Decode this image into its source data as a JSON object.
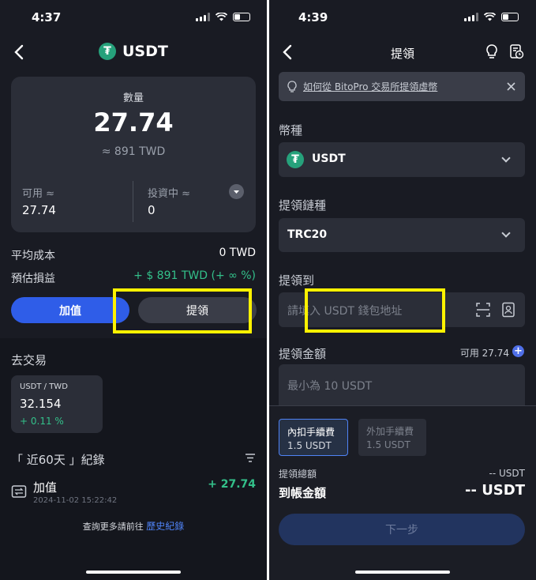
{
  "left": {
    "status_time": "4:37",
    "title": "USDT",
    "qty_label": "數量",
    "qty_value": "27.74",
    "qty_twd": "≈ 891 TWD",
    "available_label": "可用 ≈",
    "available_value": "27.74",
    "investing_label": "投資中 ≈",
    "investing_value": "0",
    "avg_cost_label": "平均成本",
    "avg_cost_value": "0 TWD",
    "pnl_label": "預估損益",
    "pnl_value": "+ $ 891 TWD (+ ∞ %)",
    "deposit_label": "加值",
    "withdraw_label": "提領",
    "trade_heading": "去交易",
    "pair_label": "USDT / TWD",
    "pair_price": "32.154",
    "pair_change": "+ 0.11 %",
    "records_heading": "「 近60天 」紀錄",
    "record_title": "加值",
    "record_time": "2024-11-02 15:22:42",
    "record_amount": "+ 27.74",
    "more_text": "查詢更多請前往",
    "more_link": "歷史紀錄"
  },
  "right": {
    "status_time": "4:39",
    "title": "提領",
    "banner_text": "如何從 BitoPro 交易所提領虛幣",
    "currency_label": "幣種",
    "currency_value": "USDT",
    "chain_label": "提領鏈種",
    "chain_value": "TRC20",
    "to_label": "提領到",
    "address_placeholder": "請填入 USDT 錢包地址",
    "amount_label": "提領金額",
    "available_text": "可用 27.74",
    "amount_placeholder": "最小為 10 USDT",
    "fee_internal_label": "內扣手續費",
    "fee_internal_value": "1.5 USDT",
    "fee_external_label": "外加手續費",
    "fee_external_value": "1.5 USDT",
    "total_label": "提領總額",
    "total_value": "-- USDT",
    "receive_label": "到帳金額",
    "receive_value": "-- USDT",
    "next_label": "下一步"
  },
  "colors": {
    "background": "#191b23",
    "card": "#2b2e38",
    "accent_blue": "#2f5de8",
    "positive_green": "#33c08a",
    "highlight_yellow": "#fff200"
  }
}
